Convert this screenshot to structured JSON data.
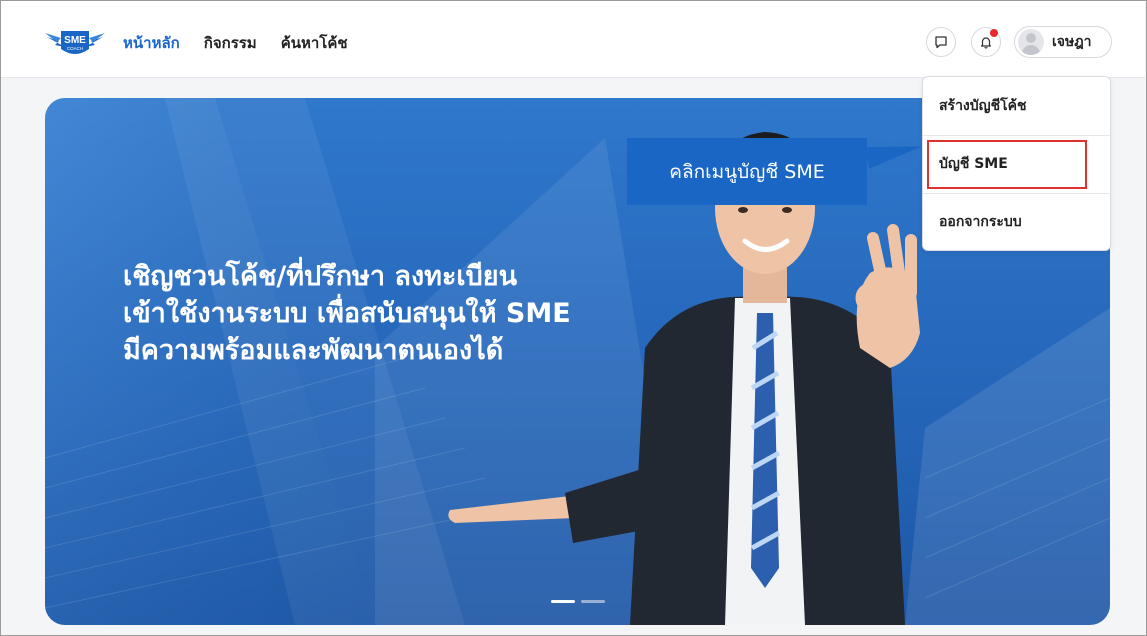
{
  "header": {
    "logo": {
      "text": "SME",
      "subtext": "COACH"
    },
    "nav": [
      {
        "label": "หน้าหลัก",
        "active": true
      },
      {
        "label": "กิจกรรม",
        "active": false
      },
      {
        "label": "ค้นหาโค้ช",
        "active": false
      }
    ],
    "icons": {
      "chat": "chat-bubble-icon",
      "notification": "bell-icon",
      "notification_badge": true
    },
    "user": {
      "name": "เจษฎา",
      "avatar_icon": "user-avatar-icon"
    }
  },
  "hero": {
    "headline_lines": [
      "เชิญชวนโค้ช/ที่ปรึกษา ลงทะเบียน",
      "เข้าใช้งานระบบ เพื่อสนับสนุนให้ SME",
      "มีความพร้อมและพัฒนาตนเองได้"
    ],
    "carousel_slides": 2,
    "carousel_active": 1
  },
  "account_menu": {
    "items": [
      {
        "label": "สร้างบัญชีโค้ช"
      },
      {
        "label": "บัญชี SME"
      },
      {
        "label": "ออกจากระบบ"
      }
    ],
    "highlighted_index": 1
  },
  "annotation": {
    "callout_text": "คลิกเมนูบัญชี SME"
  },
  "colors": {
    "brand_blue": "#1a66d1",
    "hero_blue": "#2566b9",
    "highlight_red": "#e0322d",
    "badge_red": "#e8282a"
  }
}
